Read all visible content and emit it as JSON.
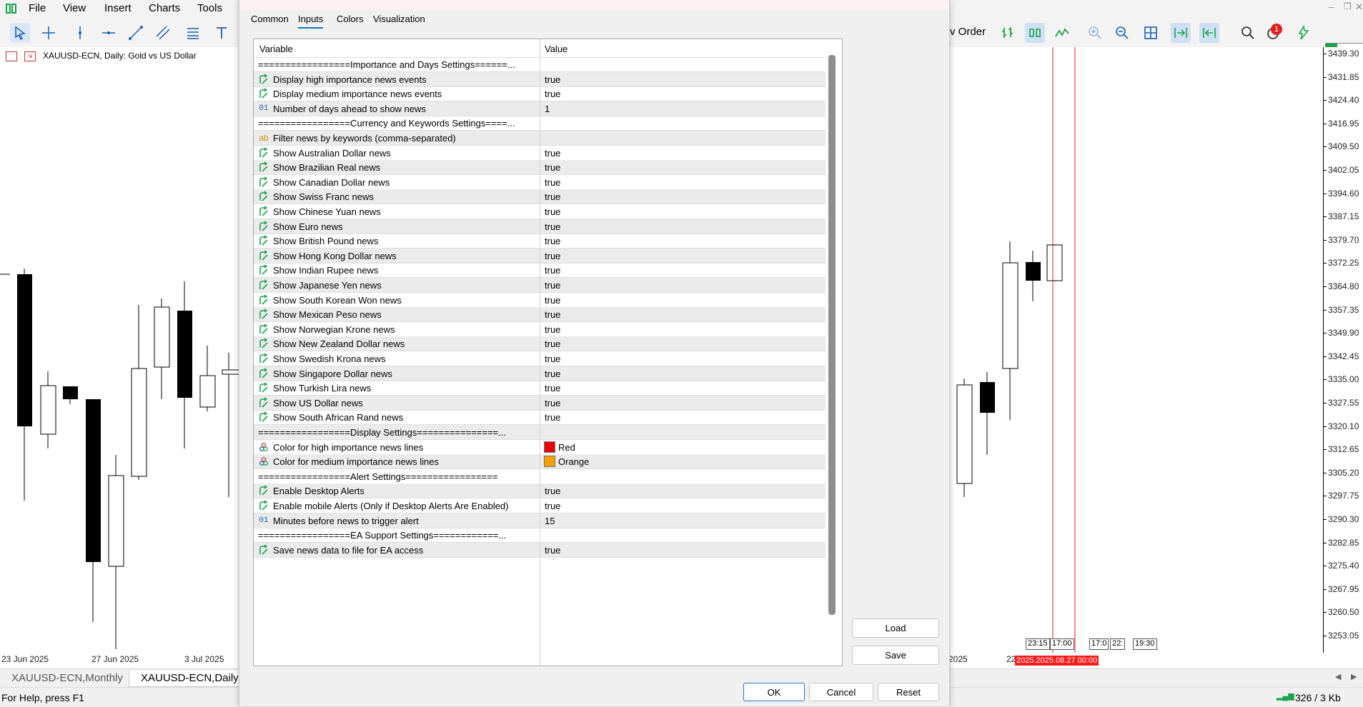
{
  "menu": [
    "File",
    "View",
    "Insert",
    "Charts",
    "Tools"
  ],
  "toolbar_right": {
    "order_label": "v Order",
    "notification_count": "1"
  },
  "chart": {
    "header": "XAUUSD-ECN, Daily:  Gold vs US Dollar",
    "prices": [
      "3439.30",
      "3431.85",
      "3424.40",
      "3416.95",
      "3409.50",
      "3402.05",
      "3394.60",
      "3387.15",
      "3379.70",
      "3372.25",
      "3364.80",
      "3357.35",
      "3349.90",
      "3342.45",
      "3335.00",
      "3327.55",
      "3320.10",
      "3312.65",
      "3305.20",
      "3297.75",
      "3290.30",
      "3282.85",
      "3275.40",
      "3267.95",
      "3260.50",
      "3253.05"
    ],
    "dates_left": [
      "23 Jun 2025",
      "27 Jun 2025",
      "3 Jul 2025"
    ],
    "dates_right": [
      "2025",
      "22"
    ],
    "time_markers": [
      "23:15",
      "17:00",
      "17:0",
      "22:",
      "19:30"
    ],
    "date_highlight": "2025.2025.08.27 00:00",
    "tabs": [
      "XAUUSD-ECN,Monthly",
      "XAUUSD-ECN,Daily"
    ]
  },
  "status": {
    "help": "For Help, press F1",
    "traffic": "326 / 3 Kb"
  },
  "dialog": {
    "tabs": [
      "Common",
      "Inputs",
      "Colors",
      "Visualization"
    ],
    "active_tab": "Inputs",
    "columns": {
      "variable": "Variable",
      "value": "Value"
    },
    "rows": [
      {
        "type": "sep",
        "name": "=================Importance and Days Settings======...",
        "value": ""
      },
      {
        "type": "bool",
        "name": "Display high importance news events",
        "value": "true"
      },
      {
        "type": "bool",
        "name": "Display medium importance news events",
        "value": "true"
      },
      {
        "type": "int",
        "name": "Number of days ahead to show news",
        "value": "1"
      },
      {
        "type": "sep",
        "name": "=================Currency and Keywords Settings====...",
        "value": ""
      },
      {
        "type": "str",
        "name": "Filter news by keywords (comma-separated)",
        "value": ""
      },
      {
        "type": "bool",
        "name": "Show Australian Dollar news",
        "value": "true"
      },
      {
        "type": "bool",
        "name": "Show Brazilian Real news",
        "value": "true"
      },
      {
        "type": "bool",
        "name": "Show Canadian Dollar news",
        "value": "true"
      },
      {
        "type": "bool",
        "name": "Show Swiss Franc news",
        "value": "true"
      },
      {
        "type": "bool",
        "name": "Show Chinese Yuan news",
        "value": "true"
      },
      {
        "type": "bool",
        "name": "Show Euro news",
        "value": "true"
      },
      {
        "type": "bool",
        "name": "Show British Pound news",
        "value": "true"
      },
      {
        "type": "bool",
        "name": "Show Hong Kong Dollar news",
        "value": "true"
      },
      {
        "type": "bool",
        "name": "Show Indian Rupee news",
        "value": "true"
      },
      {
        "type": "bool",
        "name": "Show Japanese Yen news",
        "value": "true"
      },
      {
        "type": "bool",
        "name": "Show South Korean Won news",
        "value": "true"
      },
      {
        "type": "bool",
        "name": "Show Mexican Peso news",
        "value": "true"
      },
      {
        "type": "bool",
        "name": "Show Norwegian Krone news",
        "value": "true"
      },
      {
        "type": "bool",
        "name": "Show New Zealand Dollar news",
        "value": "true"
      },
      {
        "type": "bool",
        "name": "Show Swedish Krona news",
        "value": "true"
      },
      {
        "type": "bool",
        "name": "Show Singapore Dollar news",
        "value": "true"
      },
      {
        "type": "bool",
        "name": "Show Turkish Lira news",
        "value": "true"
      },
      {
        "type": "bool",
        "name": "Show US Dollar news",
        "value": "true"
      },
      {
        "type": "bool",
        "name": "Show South African Rand news",
        "value": "true"
      },
      {
        "type": "sep",
        "name": "=================Display Settings===============...",
        "value": ""
      },
      {
        "type": "color",
        "name": "Color for high importance news lines",
        "value": "Red",
        "color": "#e8000b"
      },
      {
        "type": "color",
        "name": "Color for medium importance news lines",
        "value": "Orange",
        "color": "#f5a000"
      },
      {
        "type": "sep",
        "name": "=================Alert Settings=================",
        "value": ""
      },
      {
        "type": "bool",
        "name": "Enable Desktop Alerts",
        "value": "true"
      },
      {
        "type": "bool",
        "name": "Enable mobile Alerts (Only if Desktop Alerts Are Enabled)",
        "value": "true"
      },
      {
        "type": "int",
        "name": "Minutes before news to trigger alert",
        "value": "15"
      },
      {
        "type": "sep",
        "name": "=================EA Support Settings============...",
        "value": ""
      },
      {
        "type": "bool",
        "name": "Save news data to file for EA access",
        "value": "true"
      }
    ],
    "buttons": {
      "load": "Load",
      "save": "Save",
      "ok": "OK",
      "cancel": "Cancel",
      "reset": "Reset"
    }
  }
}
